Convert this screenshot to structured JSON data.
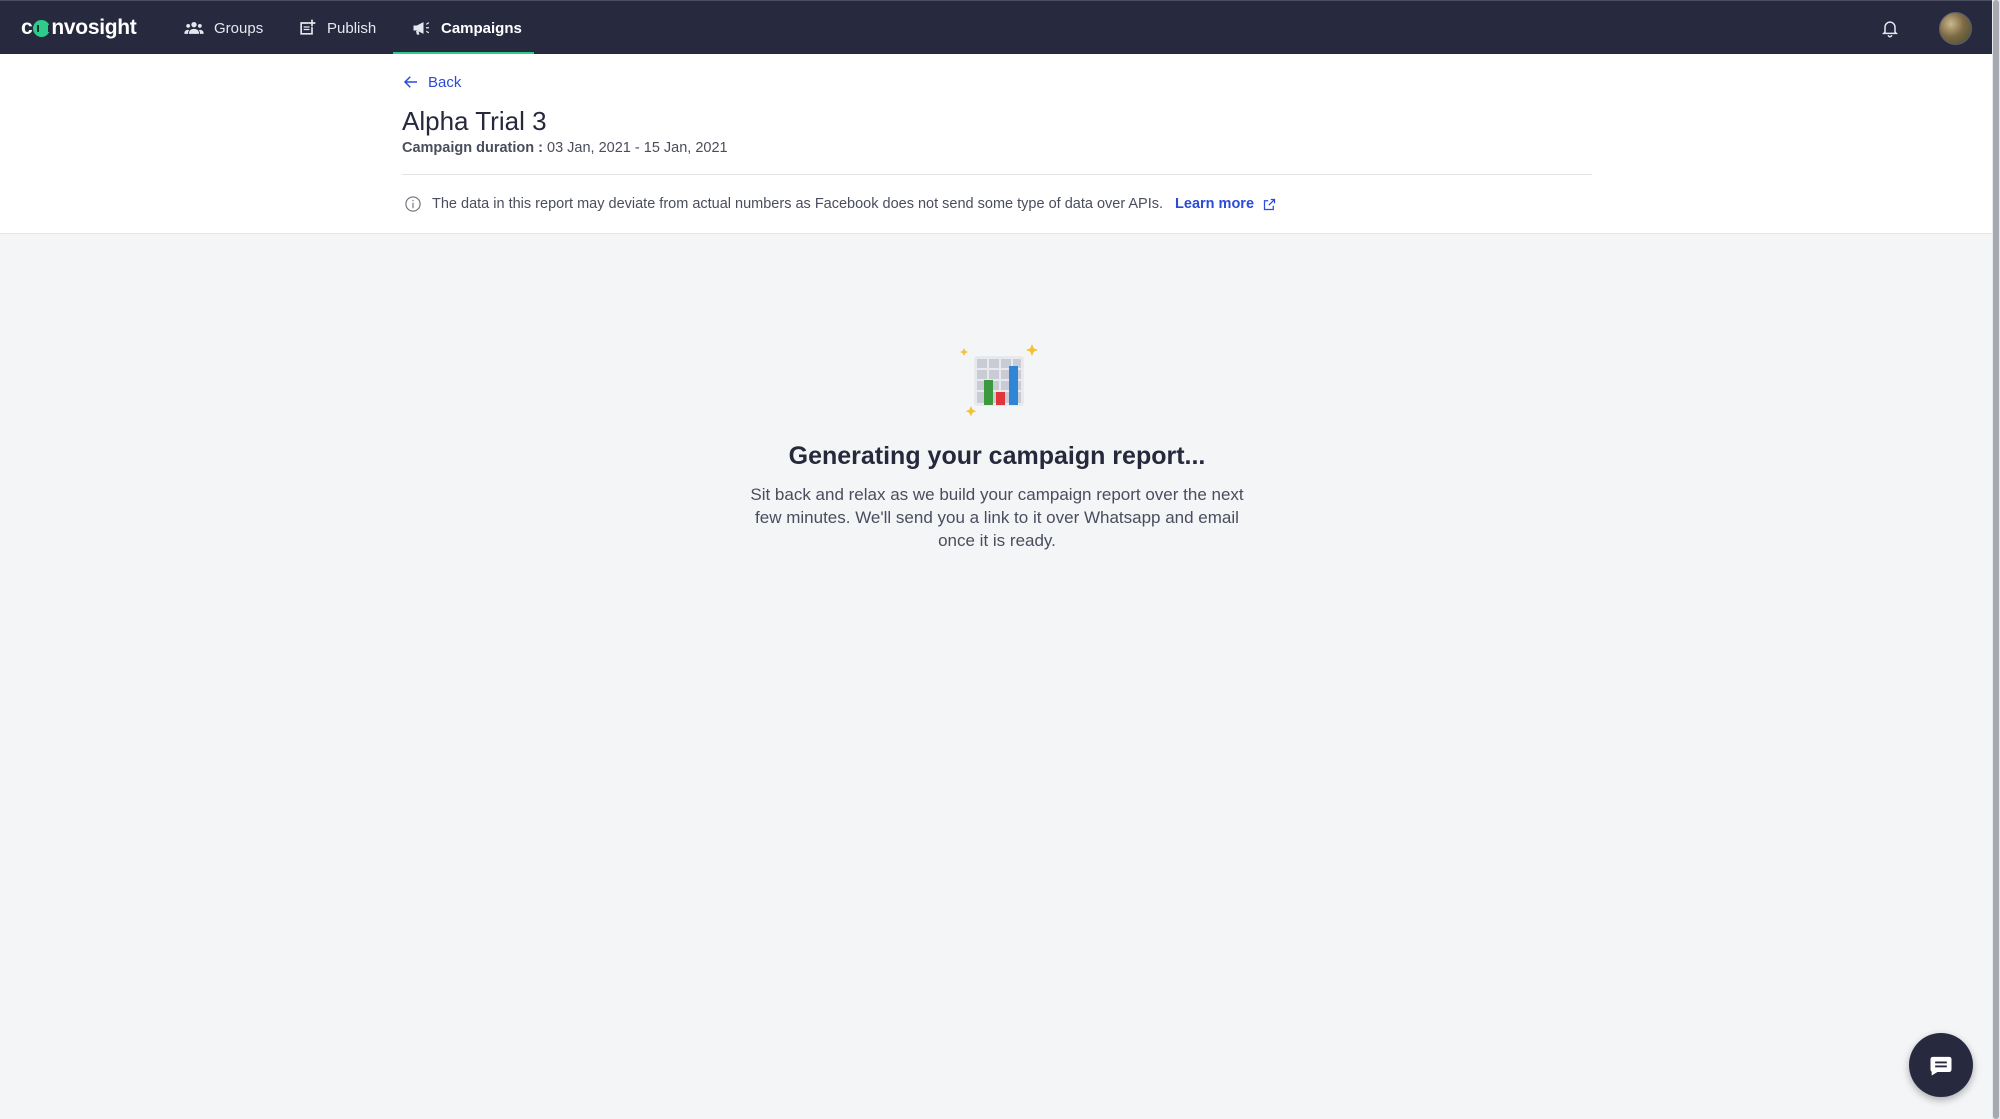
{
  "nav": {
    "logo": "convosight",
    "items": [
      {
        "label": "Groups",
        "icon": "groups-icon"
      },
      {
        "label": "Publish",
        "icon": "publish-icon"
      },
      {
        "label": "Campaigns",
        "icon": "megaphone-icon",
        "active": true
      }
    ],
    "notification_icon": "bell-icon",
    "avatar": "user-avatar"
  },
  "header": {
    "back_label": "Back",
    "title": "Alpha Trial 3",
    "duration_label": "Campaign duration :",
    "duration_value": "03 Jan, 2021 - 15 Jan, 2021",
    "notice_text": "The data in this report may deviate from actual numbers as Facebook does not send some type of data over APIs.",
    "learn_more": "Learn more"
  },
  "state": {
    "title": "Generating your campaign report...",
    "description": "Sit back and relax as we build your campaign report over the next few minutes. We'll send you a link to it over Whatsapp and email once it is ready."
  },
  "colors": {
    "nav_bg": "#272a3f",
    "accent_green": "#2ecc8a",
    "link_blue": "#2b4bd8",
    "page_bg": "#f4f5f7"
  },
  "chat": {
    "icon": "chat-icon"
  }
}
